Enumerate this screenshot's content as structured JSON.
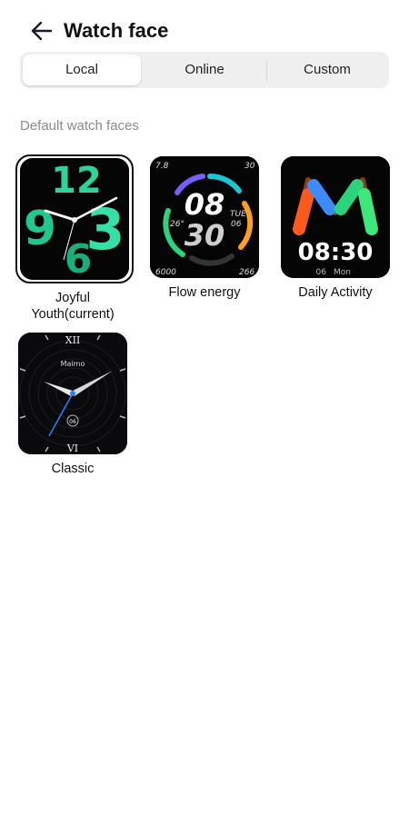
{
  "header": {
    "title": "Watch face",
    "back_icon": "arrow-left-icon"
  },
  "tabs": [
    {
      "label": "Local",
      "active": true
    },
    {
      "label": "Online",
      "active": false
    },
    {
      "label": "Custom",
      "active": false
    }
  ],
  "section_title": "Default watch faces",
  "faces": [
    {
      "name": "Joyful\nYouth(current)",
      "selected": true,
      "display": {
        "hours": "12",
        "digits": [
          "9",
          "6",
          "3"
        ]
      }
    },
    {
      "name": "Flow energy",
      "selected": false,
      "display": {
        "hour": "08",
        "minute": "30",
        "tl": "7.8",
        "tr": "30",
        "bl": "6000",
        "br": "266",
        "temp": "26°",
        "day": "TUE",
        "date": "06"
      }
    },
    {
      "name": "Daily Activity",
      "selected": false,
      "display": {
        "letter": "M",
        "time": "08:30",
        "date": "06",
        "day": "Mon"
      }
    },
    {
      "name": "Classic",
      "selected": false,
      "display": {
        "brand": "Maimo",
        "top": "XII",
        "bottom": "VI",
        "date": "06"
      }
    }
  ],
  "colors": {
    "accent_green": "#2ad49a",
    "segment_bg": "#efefef"
  }
}
